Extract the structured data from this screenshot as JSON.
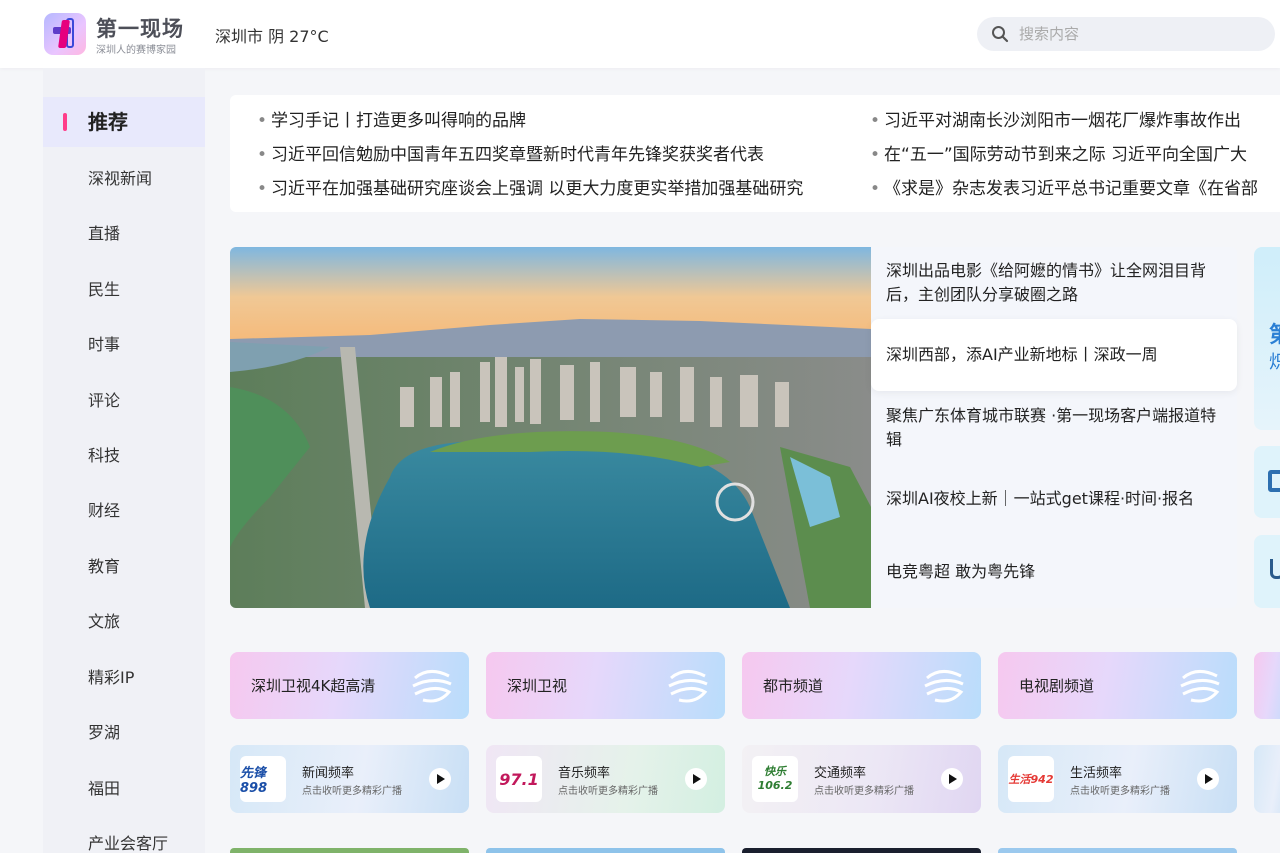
{
  "header": {
    "logo_title": "第一现场",
    "logo_subtitle": "深圳人的赛博家园",
    "weather": "深圳市 阴 27°C",
    "search_placeholder": "搜索内容"
  },
  "sidebar": {
    "items": [
      "推荐",
      "深视新闻",
      "直播",
      "民生",
      "时事",
      "评论",
      "科技",
      "财经",
      "教育",
      "文旅",
      "精彩IP",
      "罗湖",
      "福田",
      "产业会客厅"
    ]
  },
  "ticker": {
    "left": [
      "学习手记丨打造更多叫得响的品牌",
      "习近平回信勉励中国青年五四奖章暨新时代青年先锋奖获奖者代表",
      "习近平在加强基础研究座谈会上强调 以更大力度更实举措加强基础研究"
    ],
    "right": [
      "习近平对湖南长沙浏阳市一烟花厂爆炸事故作出",
      "在“五一”国际劳动节到来之际 习近平向全国广大",
      "《求是》杂志发表习近平总书记重要文章《在省部"
    ]
  },
  "hero": {
    "image_desc": "city-aerial-photo",
    "items": [
      "深圳出品电影《给阿嬷的情书》让全网泪目背后，主创团队分享破圈之路",
      "深圳西部，添AI产业新地标丨深政一周",
      "聚焦广东体育城市联赛 ·第一现场客户端报道特辑",
      "深圳AI夜校上新｜一站式get课程·时间·报名",
      "电竞粤超 敢为粤先锋"
    ],
    "side_card_chars": [
      "第",
      "炽"
    ]
  },
  "channels": [
    "深圳卫视4K超高清",
    "深圳卫视",
    "都市频道",
    "电视剧频道"
  ],
  "radios": [
    {
      "name": "新闻频率",
      "desc": "点击收听更多精彩广播",
      "logo": "先锋898",
      "logo_color": "#1b4fa8"
    },
    {
      "name": "音乐频率",
      "desc": "点击收听更多精彩广播",
      "logo": "97.1",
      "logo_color": "#c2185b"
    },
    {
      "name": "交通频率",
      "desc": "点击收听更多精彩广播",
      "logo": "快乐106.2",
      "logo_color": "#2e7d32"
    },
    {
      "name": "生活频率",
      "desc": "点击收听更多精彩广播",
      "logo": "生活942",
      "logo_color": "#e53935"
    }
  ],
  "colors": {
    "accent": "#ff3d8a",
    "sidebar_active_bg": "#e8e9fc"
  }
}
